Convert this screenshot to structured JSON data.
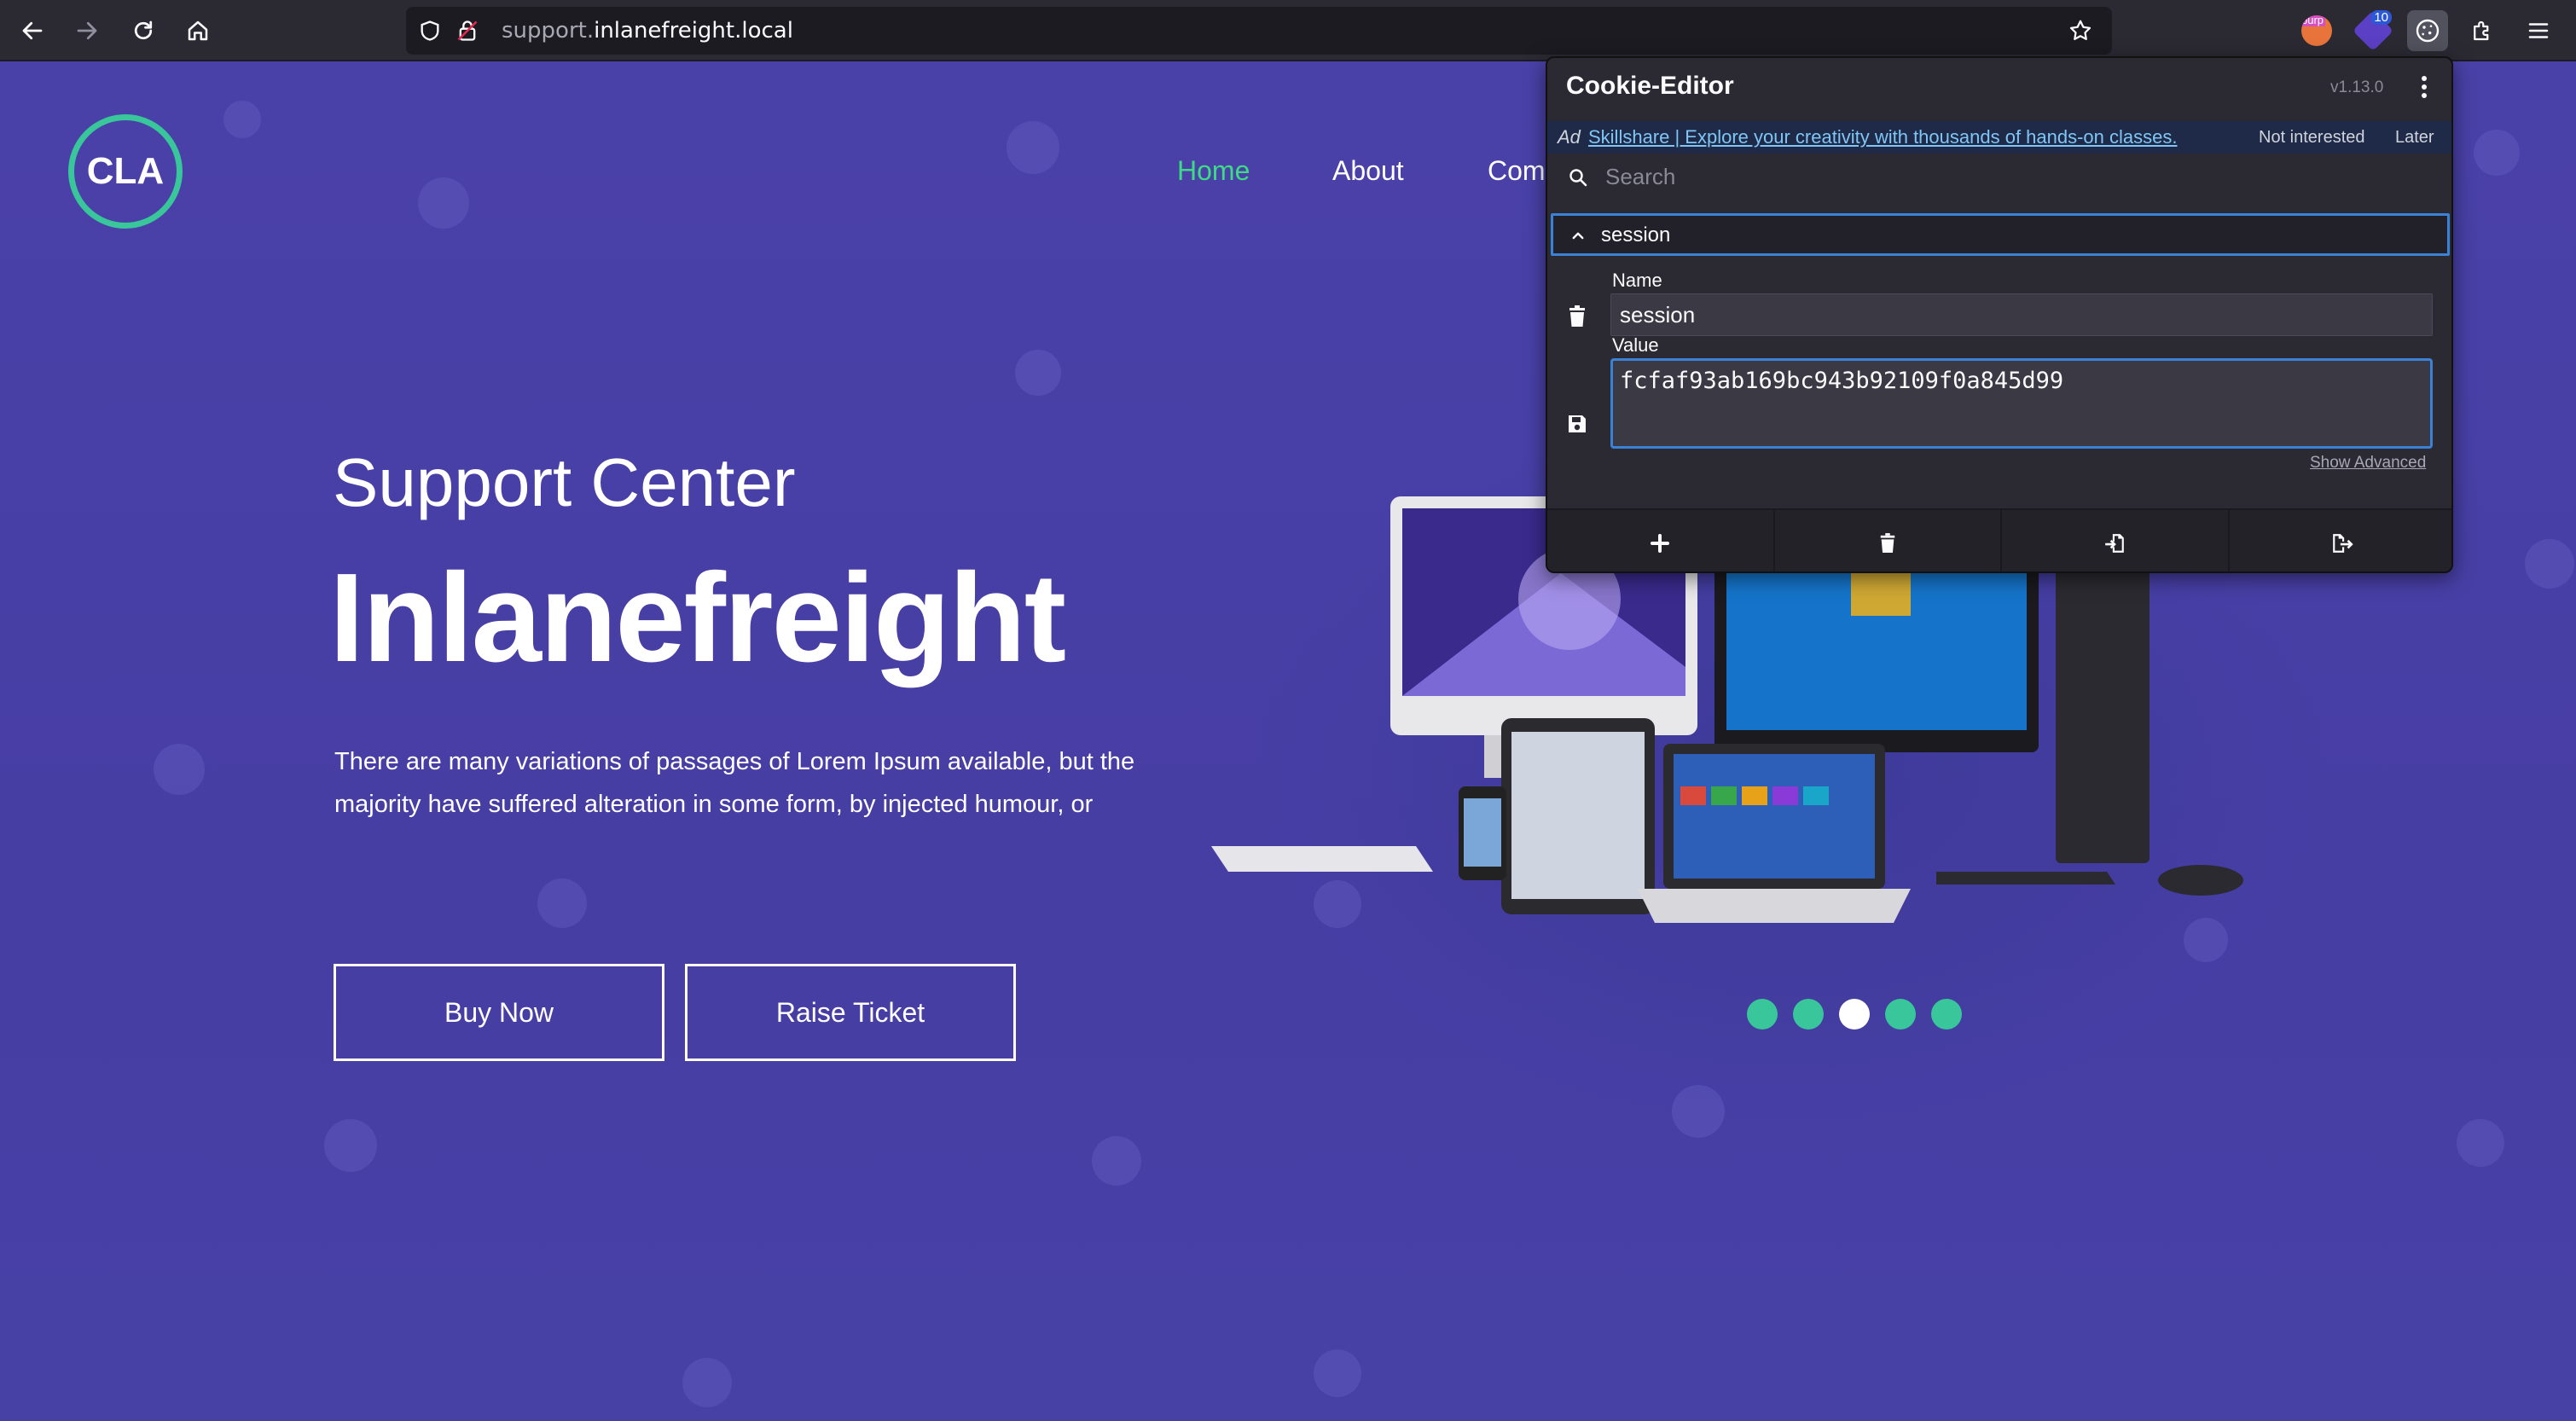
{
  "browser": {
    "url_domain_prefix": "support.",
    "url_domain_main": "inlanefreight.local",
    "extension_badge": "10",
    "burp_label": "burp"
  },
  "site": {
    "logo_text": "CLA",
    "nav": [
      {
        "label": "Home",
        "active": true
      },
      {
        "label": "About",
        "active": false
      },
      {
        "label": "Com",
        "active": false
      }
    ],
    "hero": {
      "subtitle": "Support Center",
      "title": "Inlanefreight",
      "description": "There are many variations of passages of Lorem Ipsum available, but the majority have suffered alteration in some form, by injected humour, or"
    },
    "buttons": {
      "buy": "Buy Now",
      "ticket": "Raise Ticket"
    },
    "carousel": {
      "count": 5,
      "active_index": 2
    },
    "colors": {
      "accent": "#38c69a",
      "background": "#483fa5"
    }
  },
  "cookie_editor": {
    "title": "Cookie-Editor",
    "version": "v1.13.0",
    "ad": {
      "tag": "Ad",
      "link_text": "Skillshare | Explore your creativity with thousands of hands-on classes.",
      "not_interested": "Not interested",
      "later": "Later"
    },
    "search_placeholder": "Search",
    "cookie": {
      "header_name": "session",
      "name_label": "Name",
      "name_value": "session",
      "value_label": "Value",
      "value": "fcfaf93ab169bc943b92109f0a845d99"
    },
    "show_advanced": "Show Advanced",
    "footer_icons": [
      "add-icon",
      "delete-all-icon",
      "import-icon",
      "export-icon"
    ]
  }
}
